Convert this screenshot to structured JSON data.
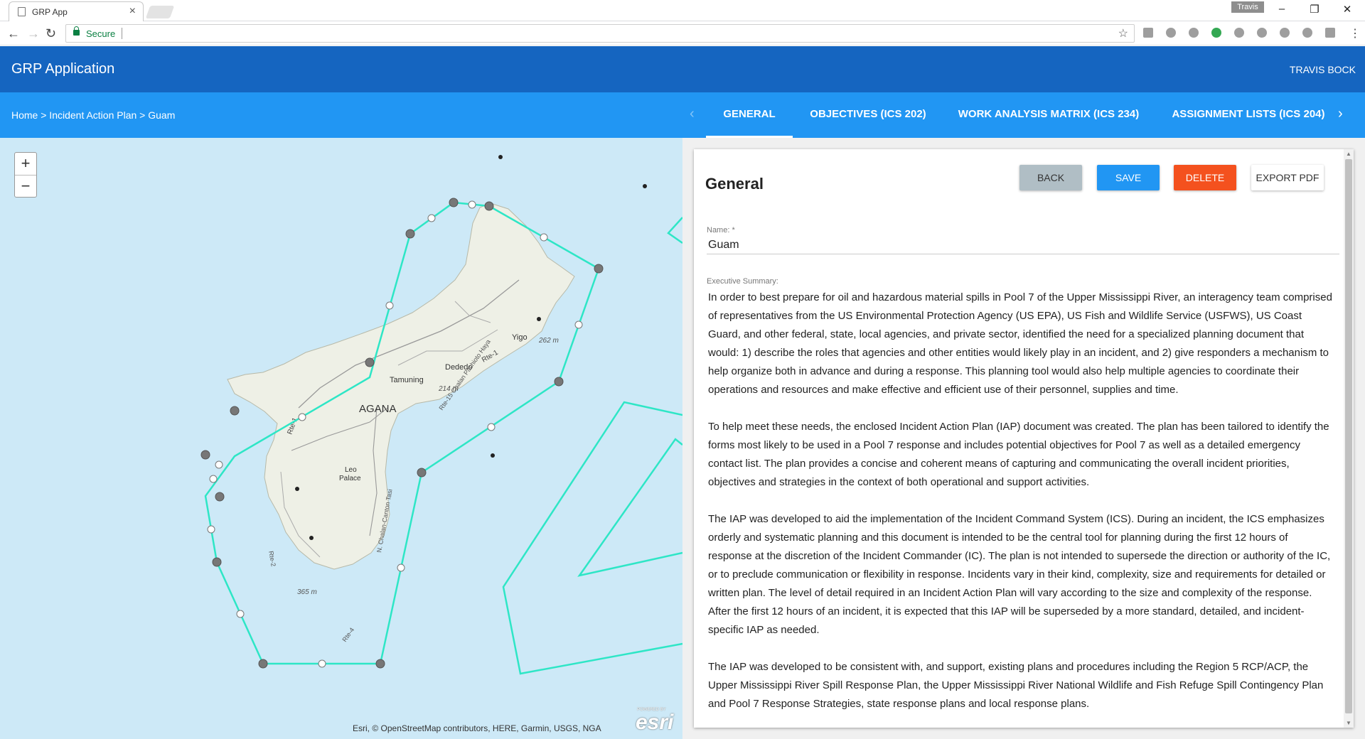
{
  "browser": {
    "tab_title": "GRP App",
    "tab_close": "×",
    "profile_name": "Travis",
    "security_label": "Secure",
    "window_controls": [
      "–",
      "❐",
      "✕"
    ]
  },
  "app": {
    "title": "GRP Application",
    "user": "TRAVIS BOCK",
    "header_color": "#1565c0",
    "nav_color": "#2196f3"
  },
  "breadcrumb": {
    "text": "Home > Incident Action Plan > Guam"
  },
  "tabs": [
    {
      "label": "GENERAL",
      "active": true
    },
    {
      "label": "OBJECTIVES (ICS 202)",
      "active": false
    },
    {
      "label": "WORK ANALYSIS MATRIX (ICS 234)",
      "active": false
    },
    {
      "label": "ASSIGNMENT LISTS (ICS 204)",
      "active": false
    }
  ],
  "map": {
    "zoom_in": "+",
    "zoom_out": "−",
    "attribution": "Esri, © OpenStreetMap contributors, HERE, Garmin, USGS, NGA",
    "logo_text": "esri",
    "logo_caption": "POWERED BY",
    "place_labels": {
      "capital": "AGANA",
      "village_1": "Tamuning",
      "village_2": "Dededo",
      "village_3": "Yigo",
      "village_4": "Leo",
      "village_5": "Palace",
      "elevation_1": "262 m",
      "elevation_2": "214 m",
      "elevation_3": "365 m",
      "route_1": "Rte-1",
      "route_2": "Rte-1",
      "route_3": "Rte-15 Chalan Pachioto Haya",
      "route_4": "N. Chalan-Canton Tasi",
      "route_5": "Rte-2",
      "route_6": "Rte-4"
    },
    "polygon_color": "#2ee6c6",
    "water_color": "#cde9f7",
    "land_color": "#eef0e6"
  },
  "general": {
    "title": "General",
    "buttons": {
      "back": "BACK",
      "save": "SAVE",
      "delete": "DELETE",
      "export": "EXPORT PDF"
    },
    "name_label": "Name: *",
    "name_value": "Guam",
    "summary_label": "Executive Summary:",
    "summary_paragraphs": [
      "In order to best prepare for oil and hazardous material spills in Pool 7 of the Upper Mississippi River, an interagency team comprised of representatives from the US Environmental Protection Agency (US EPA), US Fish and Wildlife Service (USFWS), US Coast Guard, and other federal, state, local agencies, and private sector, identified the need for a specialized planning document that would: 1) describe the roles that agencies and other entities would likely play in an incident, and 2) give responders a mechanism to help organize both in advance and during a response. This planning tool would also help multiple agencies to coordinate their operations and resources and make effective and efficient use of their personnel, supplies and time.",
      "To help meet these needs, the enclosed Incident Action Plan (IAP) document was created. The plan has been tailored to identify the forms most likely to be used in a Pool 7 response and includes potential objectives for Pool 7 as well as a detailed emergency contact list. The plan provides a concise and coherent means of capturing and communicating the overall incident priorities, objectives and strategies in the context of both operational and support activities.",
      "The IAP was developed to aid the implementation of the Incident Command System (ICS). During an incident, the ICS emphasizes orderly and systematic planning and this document is intended to be the central tool for planning during the first 12 hours of response at the discretion of the Incident Commander (IC). The plan is not intended to supersede the direction or authority of the IC, or to preclude communication or flexibility in response. Incidents vary in their kind, complexity, size and requirements for detailed or written plan. The level of detail required in an Incident Action Plan will vary according to the size and complexity of the response. After the first 12 hours of an incident, it is expected that this IAP will be superseded by a more standard, detailed, and incident-specific IAP as needed.",
      "The IAP was developed to be consistent with, and support, existing plans and procedures including the Region 5 RCP/ACP, the Upper Mississippi River Spill Response Plan, the Upper Mississippi River National Wildlife and Fish Refuge Spill Contingency Plan and Pool 7 Response Strategies, state response plans and local response plans."
    ]
  }
}
